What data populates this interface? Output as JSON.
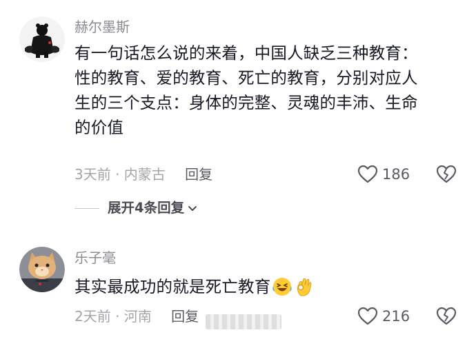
{
  "comments": [
    {
      "author": "赫尔墨斯",
      "lines": [
        "有一句话怎么说的来着，中国人缺乏三种教育：",
        "性的教育、爱的教育、死亡的教育，分别对应人",
        "生的三个支点：身体的完整、灵魂的丰沛、生命",
        "的价值"
      ],
      "time_location": "3天前 · 内蒙古",
      "reply_label": "回复",
      "likes": "186",
      "avatar_icon": "bear-figure-avatar"
    },
    {
      "author": "乐子毫",
      "text": "其实最成功的就是死亡教育",
      "emojis": [
        "laughing-crying-emoji",
        "ok-hand-emoji"
      ],
      "time_location": "2天前 · 河南",
      "reply_label": "回复",
      "likes": "216",
      "avatar_icon": "cat-avatar"
    }
  ],
  "expand_replies": {
    "label": "展开4条回复"
  },
  "colors": {
    "text": "#161823",
    "secondary": "#8a8b91",
    "meta": "#a3a4a8"
  }
}
